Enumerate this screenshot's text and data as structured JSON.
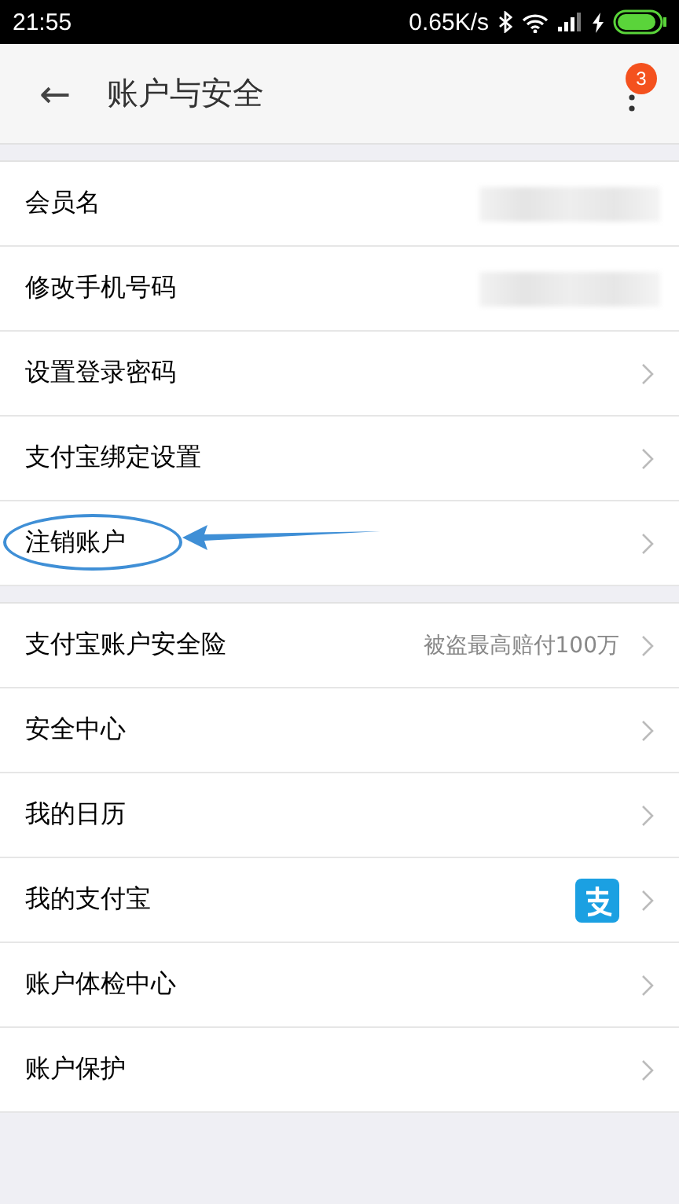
{
  "status_bar": {
    "time": "21:55",
    "speed": "0.65K/s"
  },
  "header": {
    "back": "←",
    "title": "账户与安全",
    "badge": "3"
  },
  "sections": [
    {
      "items": [
        {
          "label": "会员名",
          "kind": "masked",
          "highlighted": false
        },
        {
          "label": "修改手机号码",
          "kind": "masked",
          "highlighted": false
        },
        {
          "label": "设置登录密码",
          "kind": "link",
          "highlighted": false
        },
        {
          "label": "支付宝绑定设置",
          "kind": "link",
          "highlighted": false
        },
        {
          "label": "注销账户",
          "kind": "link",
          "highlighted": true
        }
      ]
    },
    {
      "items": [
        {
          "label": "支付宝账户安全险",
          "kind": "note",
          "note": "被盗最高赔付100万",
          "highlighted": false
        },
        {
          "label": "安全中心",
          "kind": "link",
          "highlighted": false
        },
        {
          "label": "我的日历",
          "kind": "link",
          "highlighted": false
        },
        {
          "label": "我的支付宝",
          "kind": "app",
          "highlighted": false
        },
        {
          "label": "账户体检中心",
          "kind": "link",
          "highlighted": false
        },
        {
          "label": "账户保护",
          "kind": "link",
          "highlighted": false
        }
      ]
    }
  ]
}
